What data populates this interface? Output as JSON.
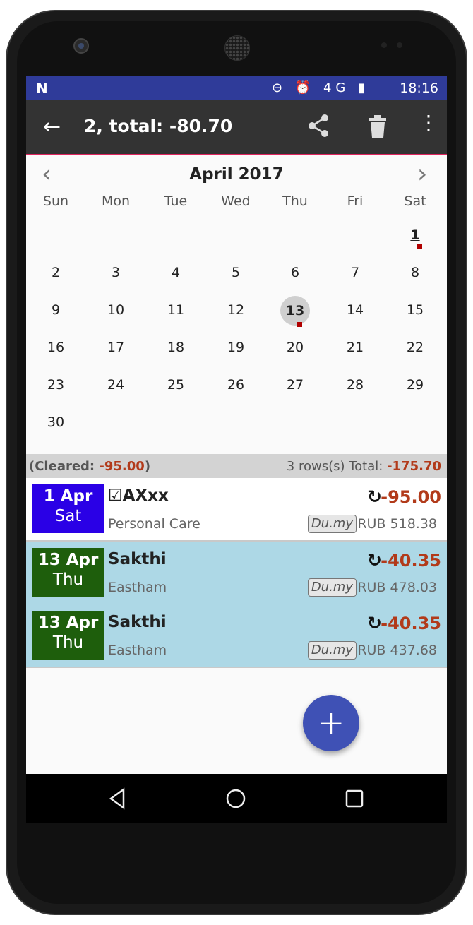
{
  "status_bar": {
    "left_icon": "N",
    "icons": "⊖ ⏰ 4G ▮",
    "time": "18:16"
  },
  "toolbar": {
    "title": "2, total: -80.70"
  },
  "calendar": {
    "month": "April 2017",
    "weekdays": [
      "Sun",
      "Mon",
      "Tue",
      "Wed",
      "Thu",
      "Fri",
      "Sat"
    ],
    "days": {
      "d1": "1",
      "d2": "2",
      "d3": "3",
      "d4": "4",
      "d5": "5",
      "d6": "6",
      "d7": "7",
      "d8": "8",
      "d9": "9",
      "d10": "10",
      "d11": "11",
      "d12": "12",
      "d13": "13",
      "d14": "14",
      "d15": "15",
      "d16": "16",
      "d17": "17",
      "d18": "18",
      "d19": "19",
      "d20": "20",
      "d21": "21",
      "d22": "22",
      "d23": "23",
      "d24": "24",
      "d25": "25",
      "d26": "26",
      "d27": "27",
      "d28": "28",
      "d29": "29",
      "d30": "30"
    },
    "selected_day": "13"
  },
  "summary": {
    "cleared_label": "(Cleared: ",
    "cleared_value": "-95.00",
    "cleared_close": ")",
    "rows_label": "3 rows(s) Total: ",
    "total_value": "-175.70"
  },
  "transactions": [
    {
      "date": "1 Apr",
      "weekday": "Sat",
      "check": "☑",
      "payee": "AXxx",
      "category": "Personal Care",
      "amount": "-95.00",
      "tag": "Du.my",
      "balance": "RUB 518.38",
      "date_color": "#2a00e6"
    },
    {
      "date": "13 Apr",
      "weekday": "Thu",
      "payee": "Sakthi",
      "category": "Eastham",
      "amount": "-40.35",
      "tag": "Du.my",
      "balance": "RUB 478.03",
      "date_color": "#1e5e0c"
    },
    {
      "date": "13 Apr",
      "weekday": "Thu",
      "payee": "Sakthi",
      "category": "Eastham",
      "amount": "-40.35",
      "tag": "Du.my",
      "balance": "RUB 437.68",
      "date_color": "#1e5e0c"
    }
  ],
  "colors": {
    "accent": "#3f51b5",
    "status_bar": "#2f3b99",
    "toolbar": "#333333",
    "selected_row": "#add8e6",
    "negative": "#b23a1a"
  }
}
